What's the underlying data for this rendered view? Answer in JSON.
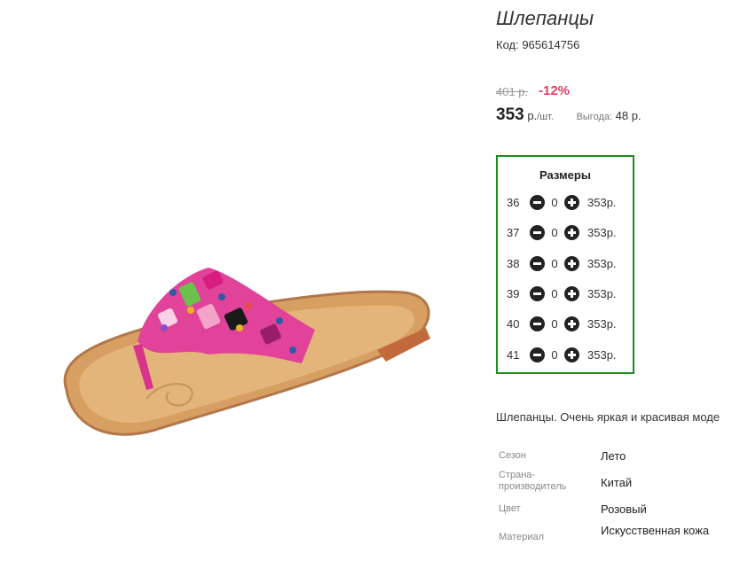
{
  "product": {
    "title": "Шлепанцы",
    "code": "Код: 965614756",
    "old_price": "401 р.",
    "discount": "-12%",
    "price": "353",
    "price_unit": "р.",
    "price_per": "/шт.",
    "savings_label": "Выгода:",
    "savings_value": "48 р."
  },
  "sizes": {
    "title": "Размеры",
    "rows": [
      {
        "size": "36",
        "qty": "0",
        "price": "353р."
      },
      {
        "size": "37",
        "qty": "0",
        "price": "353р."
      },
      {
        "size": "38",
        "qty": "0",
        "price": "353р."
      },
      {
        "size": "39",
        "qty": "0",
        "price": "353р."
      },
      {
        "size": "40",
        "qty": "0",
        "price": "353р."
      },
      {
        "size": "41",
        "qty": "0",
        "price": "353р."
      }
    ]
  },
  "description": "Шлепанцы. Очень яркая и красивая моде",
  "specs": [
    {
      "label": "Сезон",
      "value": "Лето"
    },
    {
      "label": "Страна-производитель",
      "value": "Китай"
    },
    {
      "label": "Цвет",
      "value": "Розовый"
    },
    {
      "label": "Материал",
      "value": "Искусственная кожа"
    }
  ],
  "colors": {
    "accent_border": "#1d8a1d",
    "discount": "#e33b5f"
  }
}
